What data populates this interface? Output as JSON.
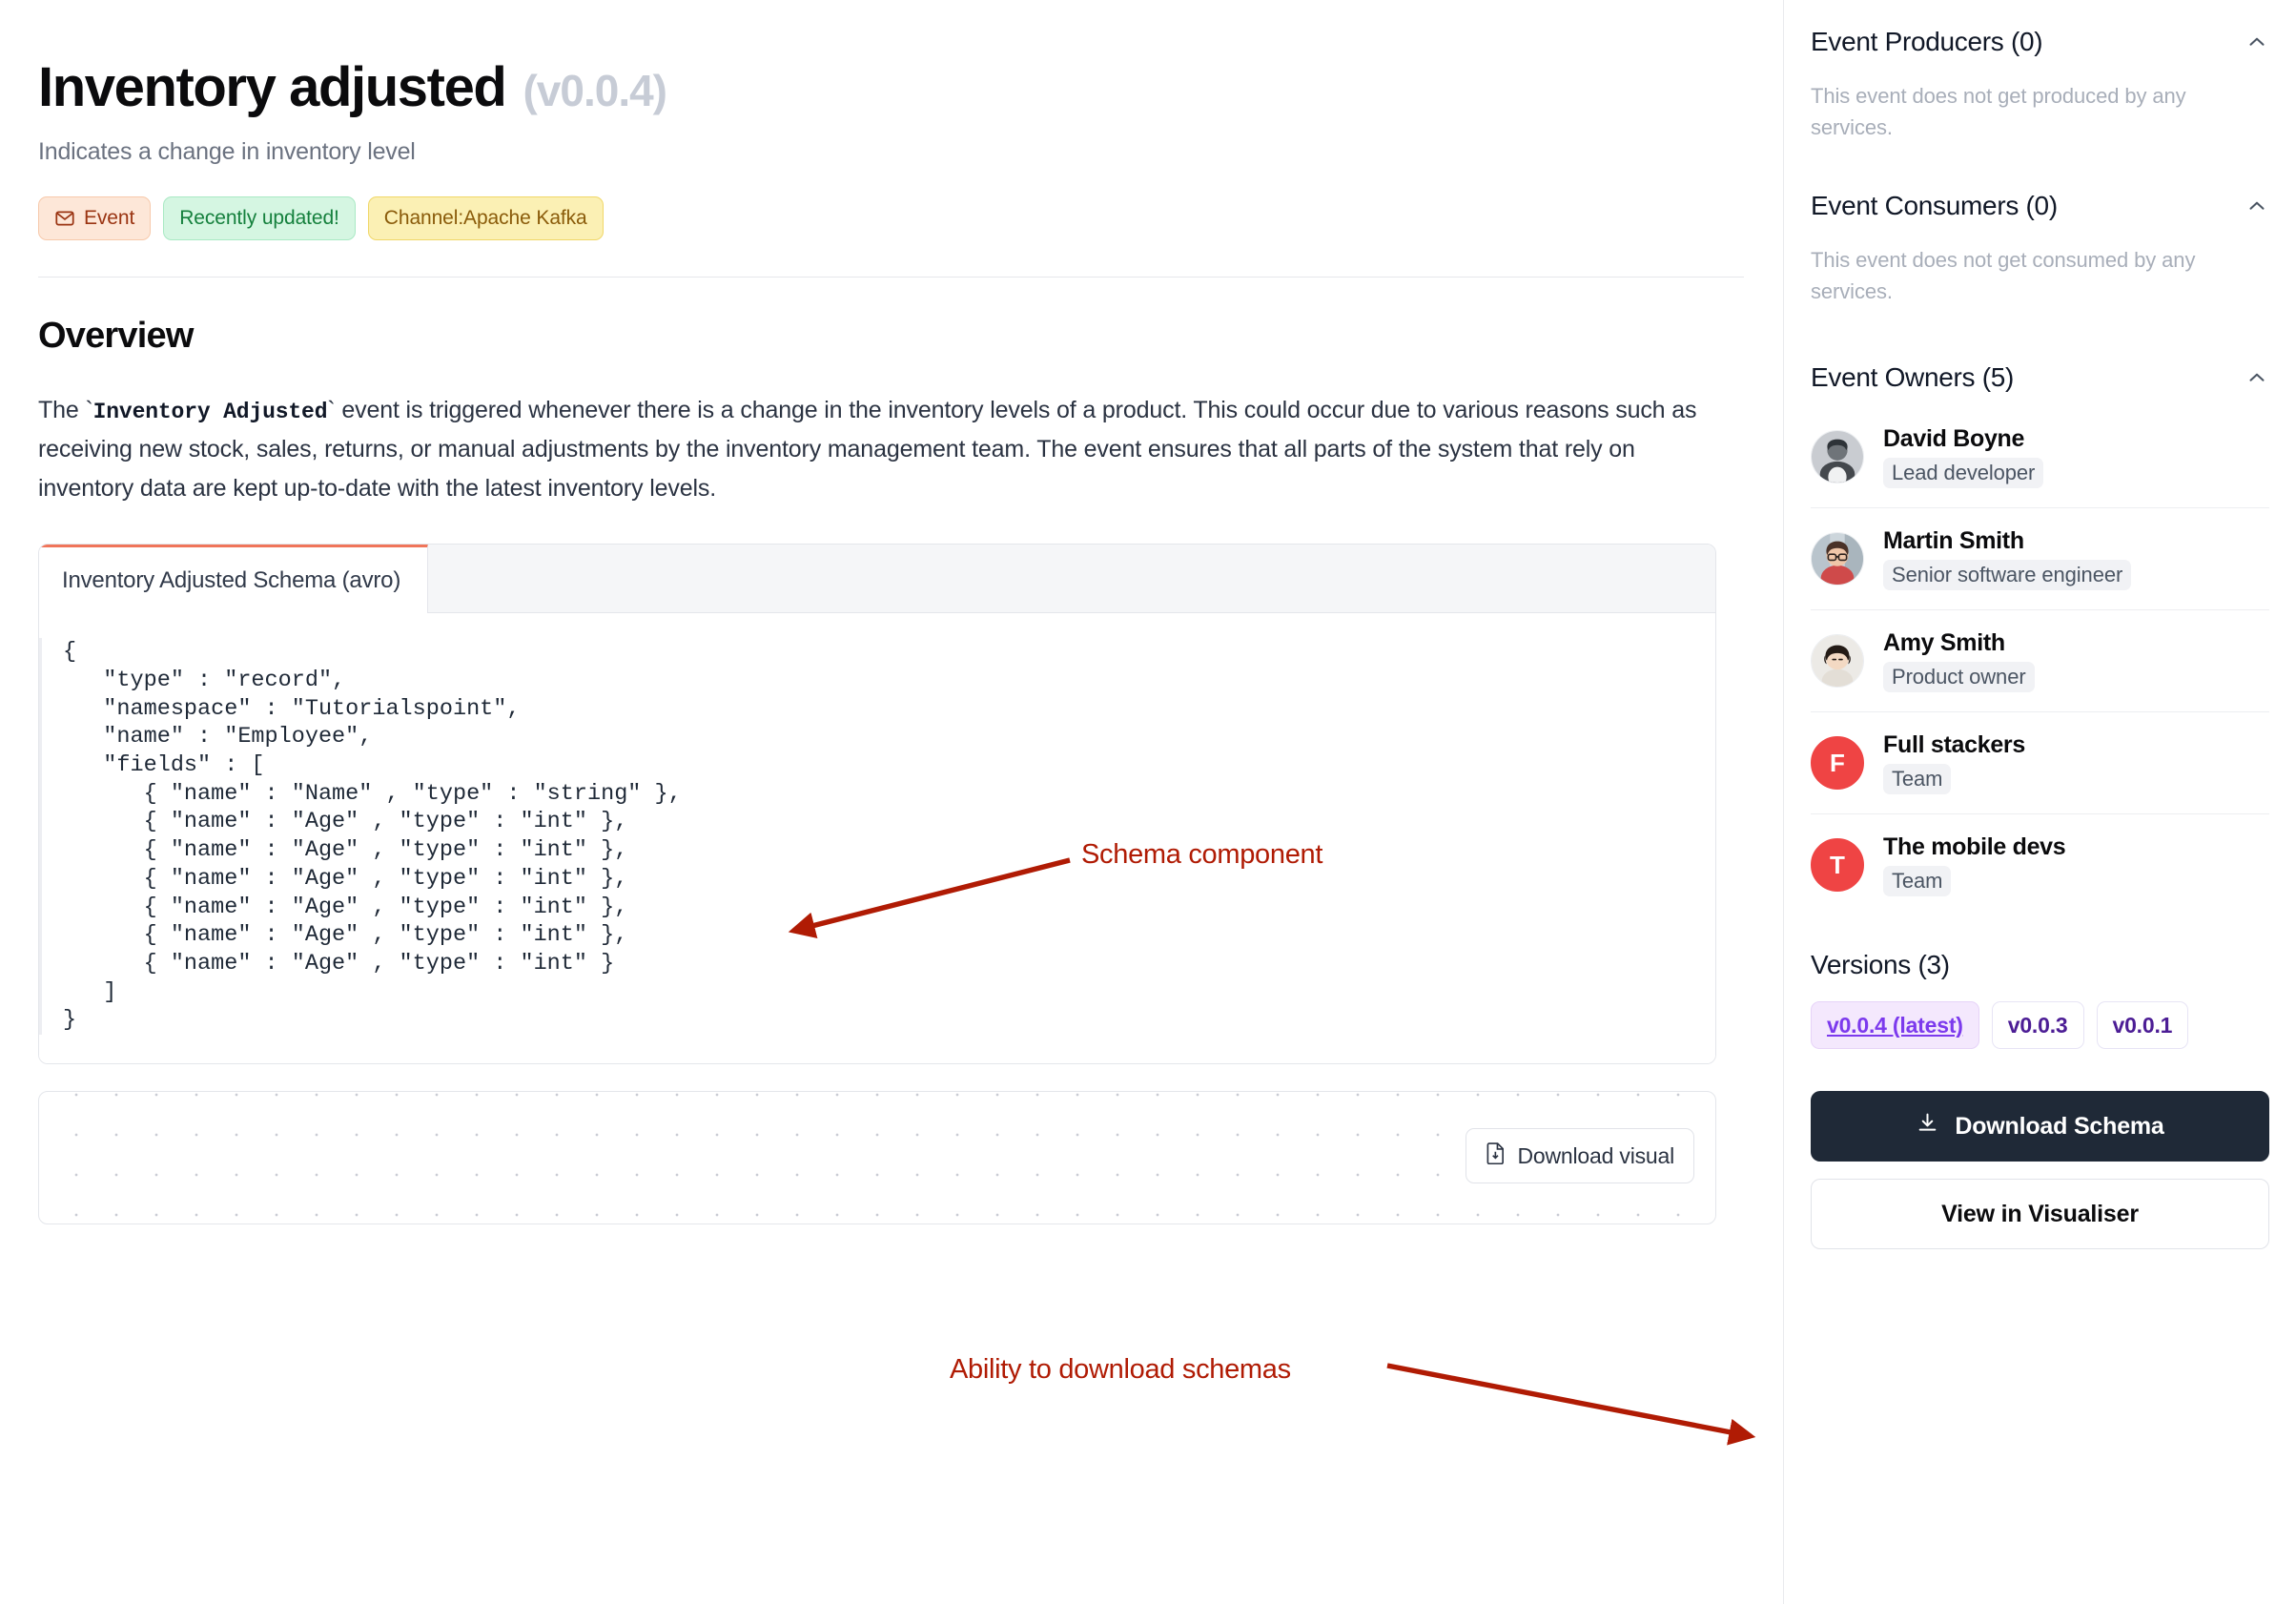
{
  "header": {
    "title": "Inventory adjusted",
    "version": "(v0.0.4)",
    "subtitle": "Indicates a change in inventory level",
    "badges": [
      {
        "label": "Event",
        "icon": "envelope-icon",
        "style": "event"
      },
      {
        "label": "Recently updated!",
        "icon": null,
        "style": "updated"
      },
      {
        "label": "Channel:Apache Kafka",
        "icon": null,
        "style": "channel"
      }
    ]
  },
  "overview": {
    "heading": "Overview",
    "paragraph_before": "The ",
    "paragraph_code": "Inventory Adjusted",
    "paragraph_after": " event is triggered whenever there is a change in the inventory levels of a product. This could occur due to various reasons such as receiving new stock, sales, returns, or manual adjustments by the inventory management team. The event ensures that all parts of the system that rely on inventory data are kept up-to-date with the latest inventory levels."
  },
  "schema_card": {
    "tab_label": "Inventory Adjusted Schema (avro)",
    "code": "{\n   \"type\" : \"record\",\n   \"namespace\" : \"Tutorialspoint\",\n   \"name\" : \"Employee\",\n   \"fields\" : [\n      { \"name\" : \"Name\" , \"type\" : \"string\" },\n      { \"name\" : \"Age\" , \"type\" : \"int\" },\n      { \"name\" : \"Age\" , \"type\" : \"int\" },\n      { \"name\" : \"Age\" , \"type\" : \"int\" },\n      { \"name\" : \"Age\" , \"type\" : \"int\" },\n      { \"name\" : \"Age\" , \"type\" : \"int\" },\n      { \"name\" : \"Age\" , \"type\" : \"int\" }\n   ]\n}"
  },
  "visual_panel": {
    "download_visual_label": "Download visual"
  },
  "sidebar": {
    "producers": {
      "title": "Event Producers (0)",
      "empty": "This event does not get produced by any services."
    },
    "consumers": {
      "title": "Event Consumers (0)",
      "empty": "This event does not get consumed by any services."
    },
    "owners": {
      "title": "Event Owners (5)",
      "items": [
        {
          "name": "David Boyne",
          "role": "Lead developer",
          "avatar_type": "photo",
          "initial": "D",
          "photo_tone": "#8d9299"
        },
        {
          "name": "Martin Smith",
          "role": "Senior software engineer",
          "avatar_type": "photo",
          "initial": "M",
          "photo_tone": "#b08a86"
        },
        {
          "name": "Amy Smith",
          "role": "Product owner",
          "avatar_type": "photo",
          "initial": "A",
          "photo_tone": "#cfc8c4"
        },
        {
          "name": "Full stackers",
          "role": "Team",
          "avatar_type": "initial",
          "initial": "F",
          "photo_tone": "#ef4444"
        },
        {
          "name": "The mobile devs",
          "role": "Team",
          "avatar_type": "initial",
          "initial": "T",
          "photo_tone": "#ef4444"
        }
      ]
    },
    "versions": {
      "title": "Versions (3)",
      "items": [
        {
          "label": "v0.0.4 (latest)",
          "latest": true
        },
        {
          "label": "v0.0.3",
          "latest": false
        },
        {
          "label": "v0.0.1",
          "latest": false
        }
      ]
    },
    "actions": {
      "download_schema": "Download Schema",
      "view_in_visualiser": "View in Visualiser"
    }
  },
  "annotations": [
    {
      "text": "Schema component",
      "color": "#b01b04"
    },
    {
      "text": "Ability to download schemas",
      "color": "#b01b04"
    }
  ],
  "colors": {
    "accent_red": "#b01b04",
    "tab_accent": "#f0755a",
    "primary_button": "#1f2937",
    "team_avatar": "#ef4444",
    "version_latest": "#7c3aed"
  }
}
